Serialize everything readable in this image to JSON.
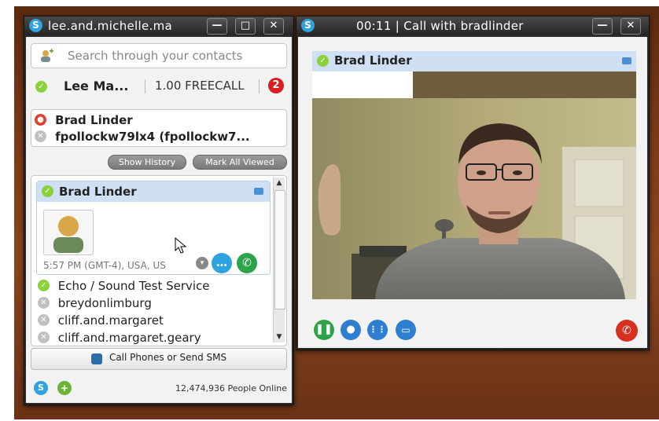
{
  "contacts_window": {
    "title": "lee.and.michelle.ma",
    "minimize": "—",
    "maximize": "□",
    "close": "✕",
    "search_placeholder": "Search through your contacts",
    "account": {
      "name": "Lee Ma...",
      "credit": "1.00 FREECALL",
      "badge_count": "2"
    },
    "recent": [
      {
        "name": "Brad Linder",
        "status": "busy"
      },
      {
        "name": "fpollockw79lx4 (fpollockw7...",
        "status": "offline"
      }
    ],
    "show_history": "Show History",
    "mark_all_viewed": "Mark All Viewed",
    "selected_contact": {
      "name": "Brad Linder",
      "local_time": "5:57 PM (GMT-4), USA, US"
    },
    "contacts": [
      {
        "name": "Echo / Sound Test Service",
        "status": "online"
      },
      {
        "name": "breydonlimburg",
        "status": "offline"
      },
      {
        "name": "cliff.and.margaret",
        "status": "offline"
      },
      {
        "name": "cliff.and.margaret.geary",
        "status": "offline"
      }
    ],
    "call_phones_label": "Call Phones or Send SMS",
    "people_online": "12,474,936 People Online"
  },
  "call_window": {
    "title": "00:11 | Call with bradlinder",
    "minimize": "—",
    "close": "✕",
    "caller_name": "Brad Linder"
  },
  "colors": {
    "online": "#8ad23a",
    "busy": "#e04030",
    "skype_blue": "#2fa2e0",
    "hangup": "#d83020"
  }
}
